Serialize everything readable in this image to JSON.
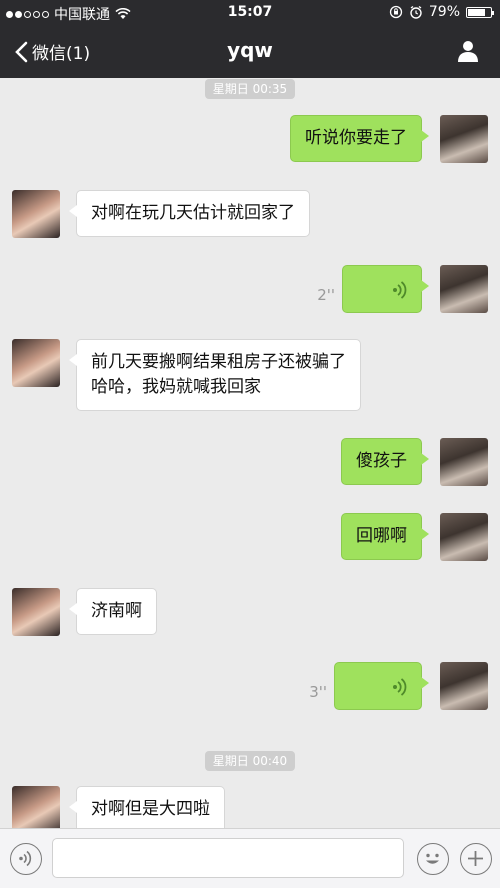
{
  "status_bar": {
    "carrier": "中国联通",
    "time": "15:07",
    "battery": "79%",
    "battery_level": 0.79
  },
  "nav": {
    "back_label": "微信(1)",
    "title": "yqw"
  },
  "messages": {
    "time1": "星期日 00:35",
    "m1": "听说你要走了",
    "m2": "对啊在玩几天估计就回家了",
    "m3_duration": "2''",
    "m4_line1": "前几天要搬啊结果租房子还被骗了",
    "m4_line2": "哈哈，我妈就喊我回家",
    "m5": "傻孩子",
    "m6": "回哪啊",
    "m7": "济南啊",
    "m8_duration": "3''",
    "time2": "星期日 00:40",
    "m9": "对啊但是大四啦"
  },
  "input": {
    "value": "",
    "placeholder": ""
  },
  "icons": {
    "voice_toggle": "voice-toggle-icon",
    "emoji": "emoji-icon",
    "add": "add-icon",
    "profile": "profile-icon",
    "back": "chevron-left-icon"
  },
  "colors": {
    "outgoing_bubble": "#9fe15d",
    "incoming_bubble": "#ffffff",
    "nav_bg": "#2b2b2e",
    "chat_bg": "#ebebeb"
  }
}
